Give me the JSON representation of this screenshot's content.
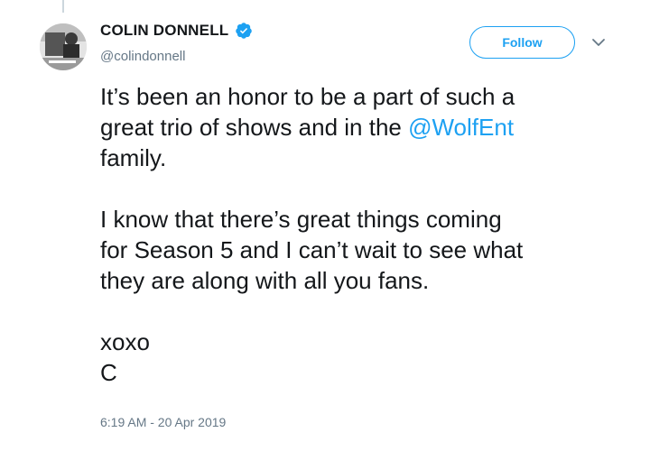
{
  "tweet": {
    "author": {
      "display_name": "COLIN DONNELL",
      "handle": "@colindonnell",
      "verified": true
    },
    "follow_label": "Follow",
    "paragraphs": [
      {
        "lines": [
          "It’s been an honor to be a part of such a",
          "great trio of shows and in the ",
          "family."
        ],
        "mention": "@WolfEnt"
      },
      {
        "lines": [
          "I know that there’s great things coming",
          "for Season 5 and I can’t wait to see what",
          "they are along with all you fans."
        ]
      },
      {
        "lines": [
          "xoxo",
          "C"
        ]
      }
    ],
    "timestamp": "6:19 AM - 20 Apr 2019"
  },
  "colors": {
    "accent": "#1da1f2",
    "text": "#14171a",
    "muted": "#657786"
  },
  "icons": {
    "verified": "verified-badge-icon",
    "menu": "chevron-down-icon"
  }
}
